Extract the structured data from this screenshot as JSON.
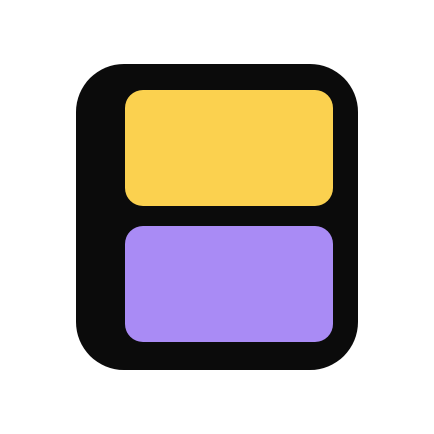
{
  "icon": {
    "name": "layout-panels-icon",
    "colors": {
      "frame": "#0b0b0b",
      "top_panel": "#fbd14f",
      "bottom_panel": "#a98bf5",
      "background": "#ffffff"
    }
  }
}
